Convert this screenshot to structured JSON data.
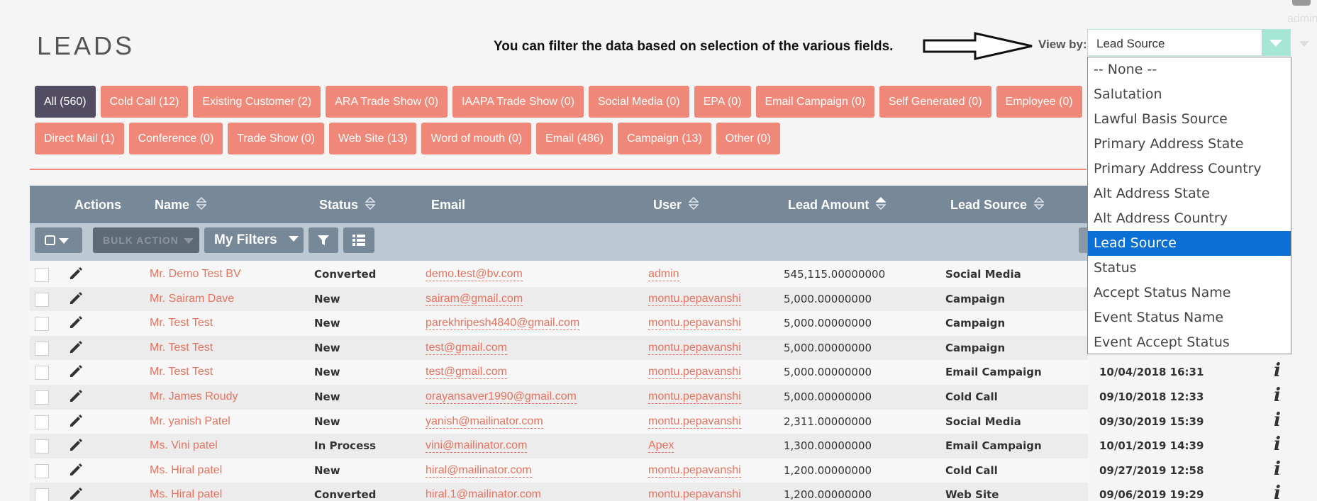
{
  "header": {
    "title": "LEADS",
    "hint": "You can filter the data based on selection of the various fields.",
    "view_by_label": "View by:",
    "admin_label": "admin"
  },
  "view_by": {
    "selected": "Lead Source",
    "options": [
      "-- None --",
      "Salutation",
      "Lawful Basis Source",
      "Primary Address State",
      "Primary Address Country",
      "Alt Address State",
      "Alt Address Country",
      "Lead Source",
      "Status",
      "Accept Status Name",
      "Event Status Name",
      "Event Accept Status"
    ],
    "selected_index": 7
  },
  "filters_row1": [
    "All (560)",
    "Cold Call (12)",
    "Existing Customer (2)",
    "ARA Trade Show (0)",
    "IAAPA Trade Show (0)",
    "Social Media (0)",
    "EPA (0)",
    "Email Campaign (0)",
    "Self Generated (0)",
    "Employee (0)"
  ],
  "filters_row2": [
    "Direct Mail (1)",
    "Conference (0)",
    "Trade Show (0)",
    "Web Site (13)",
    "Word of mouth (0)",
    "Email (486)",
    "Campaign (13)",
    "Other (0)"
  ],
  "table": {
    "columns": {
      "actions": "Actions",
      "name": "Name",
      "status": "Status",
      "email": "Email",
      "user": "User",
      "amount": "Lead Amount",
      "source": "Lead Source"
    },
    "toolbar": {
      "bulk_action": "BULK ACTION",
      "my_filters": "My Filters"
    },
    "rows": [
      {
        "name": "Mr. Demo Test BV",
        "status": "Converted",
        "email": "demo.test@bv.com",
        "user": "admin",
        "amount": "545,115.00000000",
        "source": "Social Media",
        "date": ""
      },
      {
        "name": "Mr. Sairam Dave",
        "status": "New",
        "email": "sairam@gmail.com",
        "user": "montu.pepavanshi",
        "amount": "5,000.00000000",
        "source": "Campaign",
        "date": ""
      },
      {
        "name": "Mr. Test Test",
        "status": "New",
        "email": "parekhripesh4840@gmail.com",
        "user": "montu.pepavanshi",
        "amount": "5,000.00000000",
        "source": "Campaign",
        "date": ""
      },
      {
        "name": "Mr. Test Test",
        "status": "New",
        "email": "test@gmail.com",
        "user": "montu.pepavanshi",
        "amount": "5,000.00000000",
        "source": "Campaign",
        "date": ""
      },
      {
        "name": "Mr. Test Test",
        "status": "New",
        "email": "test@gmail.com",
        "user": "montu.pepavanshi",
        "amount": "5,000.00000000",
        "source": "Email Campaign",
        "date": "10/04/2018 16:31"
      },
      {
        "name": "Mr. James Roudy",
        "status": "New",
        "email": "orayansaver1990@gmail.com",
        "user": "montu.pepavanshi",
        "amount": "5,000.00000000",
        "source": "Cold Call",
        "date": "09/10/2018 12:33"
      },
      {
        "name": "Mr. yanish Patel",
        "status": "New",
        "email": "yanish@mailinator.com",
        "user": "montu.pepavanshi",
        "amount": "2,311.00000000",
        "source": "Social Media",
        "date": "09/30/2019 15:39"
      },
      {
        "name": "Ms. Vini patel",
        "status": "In Process",
        "email": "vini@mailinator.com",
        "user": "Apex",
        "amount": "1,300.00000000",
        "source": "Email Campaign",
        "date": "10/01/2019 14:39"
      },
      {
        "name": "Ms. Hiral patel",
        "status": "New",
        "email": "hiral@mailinator.com",
        "user": "montu.pepavanshi",
        "amount": "1,200.00000000",
        "source": "Cold Call",
        "date": "09/27/2019 12:58"
      },
      {
        "name": "Ms. Hiral patel",
        "status": "Converted",
        "email": "hiral.1@mailinator.com",
        "user": "montu.pepavanshi",
        "amount": "1,200.00000000",
        "source": "Web Site",
        "date": "09/06/2019 19:29"
      }
    ]
  },
  "colors": {
    "chip": "#ef8878",
    "chip_active": "#534d64",
    "table_header": "#778898",
    "link": "#e8725e",
    "selected_option": "#0a70d6"
  }
}
